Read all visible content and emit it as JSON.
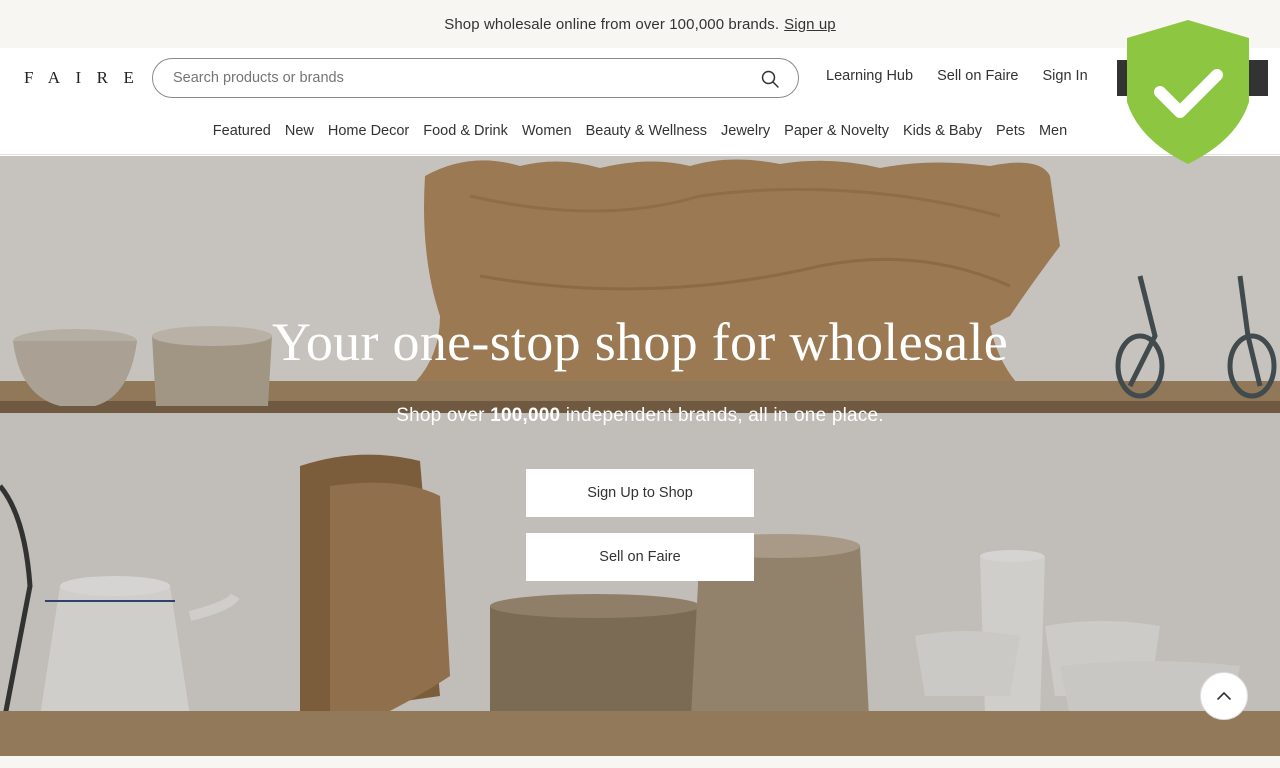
{
  "announcement": {
    "text": "Shop wholesale online from over 100,000 brands.",
    "link": "Sign up"
  },
  "header": {
    "logo": "FAIRE",
    "search_placeholder": "Search products or brands",
    "links": [
      "Learning Hub",
      "Sell on Faire",
      "Sign In"
    ]
  },
  "categories": [
    "Featured",
    "New",
    "Home Decor",
    "Food & Drink",
    "Women",
    "Beauty & Wellness",
    "Jewelry",
    "Paper & Novelty",
    "Kids & Baby",
    "Pets",
    "Men"
  ],
  "hero": {
    "title": "Your one-stop shop for wholesale",
    "subtitle_pre": "Shop over",
    "subtitle_bold": "100,000",
    "subtitle_post": "independent brands, all in one place.",
    "primary_button": "Sign Up to Shop",
    "secondary_button": "Sell on Faire"
  },
  "icons": {
    "search": "search-icon",
    "shield": "shield-check-icon",
    "scroll_top": "chevron-up-icon"
  },
  "colors": {
    "shield": "#8dc641",
    "dark_button": "#333333",
    "announce_bg": "#f8f6f3"
  }
}
